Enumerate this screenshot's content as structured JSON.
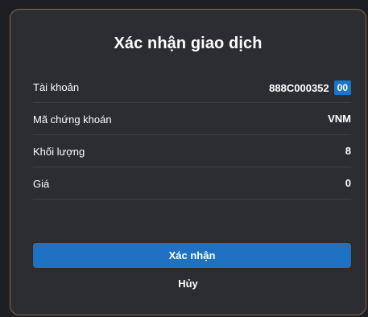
{
  "dialog": {
    "title": "Xác nhận giao dịch",
    "rows": [
      {
        "label": "Tài khoản",
        "value": "888C000352",
        "badge": "00"
      },
      {
        "label": "Mã chứng khoán",
        "value": "VNM"
      },
      {
        "label": "Khối lượng",
        "value": "8"
      },
      {
        "label": "Giá",
        "value": "0"
      }
    ],
    "confirm_label": "Xác nhận",
    "cancel_label": "Hủy"
  },
  "colors": {
    "dialog_bg": "#2c2d31",
    "accent": "#1f72c1",
    "border": "#8a6a4a"
  }
}
